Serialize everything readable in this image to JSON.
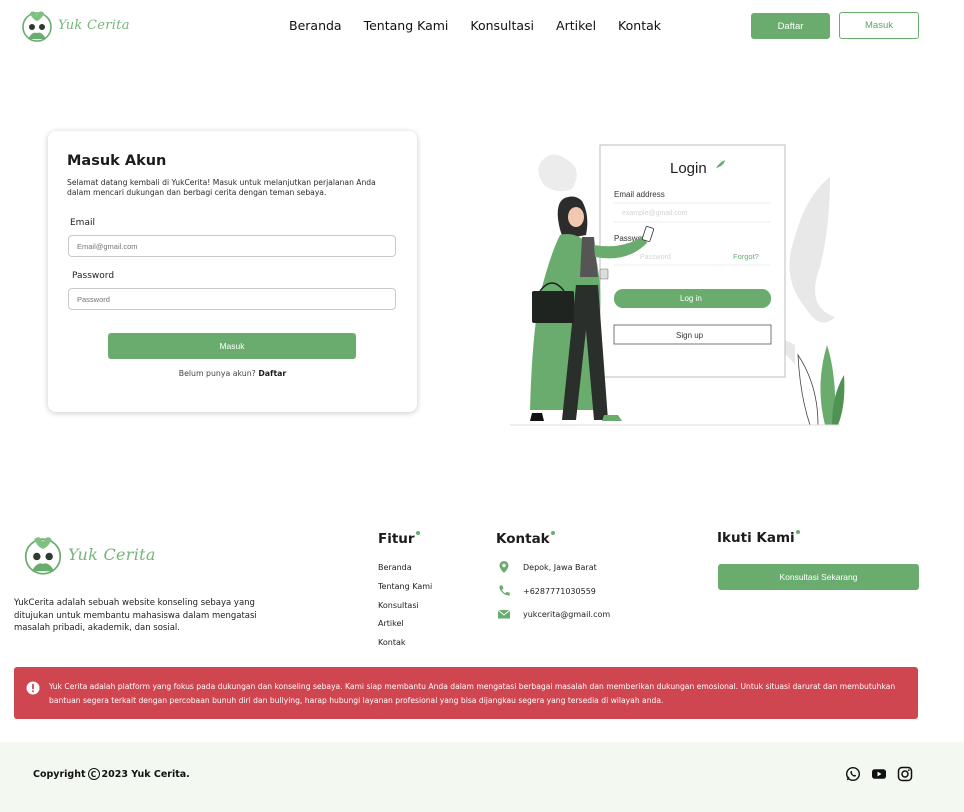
{
  "brand": {
    "name": "Yuk Cerita"
  },
  "nav": {
    "links": [
      "Beranda",
      "Tentang Kami",
      "Konsultasi",
      "Artikel",
      "Kontak"
    ],
    "register_label": "Daftar",
    "login_label": "Masuk"
  },
  "login_card": {
    "title": "Masuk Akun",
    "description": "Selamat datang kembali di YukCerita! Masuk untuk melanjutkan perjalanan Anda dalam mencari dukungan dan berbagi cerita dengan teman sebaya.",
    "email_label": "Email",
    "email_placeholder": "Email@gmail.com",
    "password_label": "Password",
    "password_placeholder": "Password",
    "submit_label": "Masuk",
    "register_prompt": "Belum punya akun?",
    "register_link": "Daftar"
  },
  "illustration": {
    "title": "Login",
    "email_label": "Email address",
    "email_placeholder": "example@gmail.com",
    "password_label": "Password",
    "password_placeholder": "Password",
    "forgot_label": "Forgot?",
    "login_label": "Log in",
    "signup_label": "Sign up"
  },
  "footer": {
    "about": "YukCerita adalah sebuah website konseling sebaya yang ditujukan untuk membantu mahasiswa dalam mengatasi masalah pribadi, akademik, dan sosial.",
    "fitur_title": "Fitur",
    "fitur_items": [
      "Beranda",
      "Tentang Kami",
      "Konsultasi",
      "Artikel",
      "Kontak"
    ],
    "kontak_title": "Kontak",
    "location": "Depok, Jawa Barat",
    "phone": "+6287771030559",
    "email": "yukcerita@gmail.com",
    "ikuti_title": "Ikuti Kami",
    "consult_label": "Konsultasi Sekarang"
  },
  "alert": {
    "text": "Yuk Cerita adalah platform yang fokus pada dukungan dan konseling sebaya. Kami siap membantu Anda dalam mengatasi berbagai masalah dan memberikan dukungan emosional. Untuk situasi darurat dan membutuhkan bantuan segera terkait dengan percobaan bunuh diri dan bullying, harap hubungi layanan profesional yang bisa dijangkau segera yang tersedia di wilayah anda."
  },
  "bottom": {
    "copyright_prefix": "Copyright",
    "copyright_text": "2023 Yuk Cerita.",
    "social_icons": [
      "whatsapp-icon",
      "youtube-icon",
      "instagram-icon"
    ]
  },
  "colors": {
    "accent": "#6aac6e",
    "alert": "#cf4550",
    "bottom_bg": "#f3f8f1"
  }
}
